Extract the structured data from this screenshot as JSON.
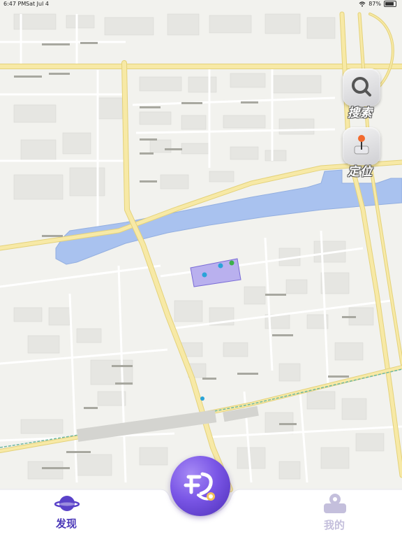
{
  "status_bar": {
    "time": "6:47 PM",
    "date": "Sat Jul 4",
    "battery": "87%",
    "battery_level": 0.87
  },
  "controls": {
    "search_label": "搜索",
    "locate_label": "定位"
  },
  "tabbar": {
    "discover_label": "发现",
    "mine_label": "我的",
    "discover_color": "#4a37b8",
    "mine_color": "#c4bfdc"
  },
  "map": {
    "river_color": "#a9c2ef",
    "major_road_color": "#f7e9a6",
    "polygon_color": "#b9b0ee"
  }
}
